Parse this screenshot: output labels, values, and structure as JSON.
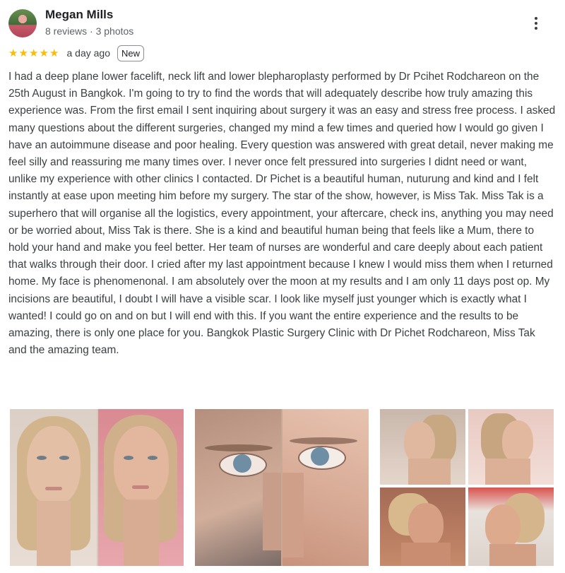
{
  "review": {
    "author": "Megan Mills",
    "author_meta": "8 reviews · 3 photos",
    "rating": 5,
    "stars": [
      "★",
      "★",
      "★",
      "★",
      "★"
    ],
    "time": "a day ago",
    "badge": "New",
    "text": "I had a deep plane lower facelift, neck lift and lower blepharoplasty performed by Dr Pcihet Rodchareon on the 25th August in Bangkok. I'm going to try to find the words that will adequately describe how truly amazing this experience was. From the first email I sent inquiring about surgery it was an easy and stress free process. I asked many questions about the different surgeries, changed my mind a few times and queried how I would go given I have an autoimmune disease and poor healing. Every question was answered with great detail, never making me feel silly and reassuring me many times over. I never once felt pressured into surgeries I didnt need or want, unlike my experience with other clinics I contacted. Dr Pichet is a beautiful human, nuturung and kind and I felt instantly at ease upon meeting him before my surgery. The star of the show, however, is Miss Tak. Miss Tak is a superhero that will organise all the logistics, every appointment, your aftercare, check ins, anything you may need or be worried about, Miss Tak is there. She is a kind and beautiful human being that feels like a Mum, there to hold your hand and make you feel better. Her team of nurses are wonderful and care deeply about each patient that walks through their door. I cried after my last appointment because I knew I would miss them when I returned home. My face is phenomenonal. I am absolutely over the moon at my results and I am only 11 days post op. My incisions are beautiful, I doubt I will have a visible scar. I look like myself just younger which is exactly what I wanted! I could go on and on but I will end with this. If you want the entire experience and the results to be amazing, there is only one place for you. Bangkok Plastic Surgery Clinic with Dr Pichet Rodchareon, Miss Tak and the amazing team."
  },
  "icons": {
    "more": "more-vert-icon",
    "star": "star-icon"
  },
  "colors": {
    "star": "#fbbc04",
    "text": "#3c4043",
    "name": "#202124",
    "meta": "#5f6368"
  }
}
